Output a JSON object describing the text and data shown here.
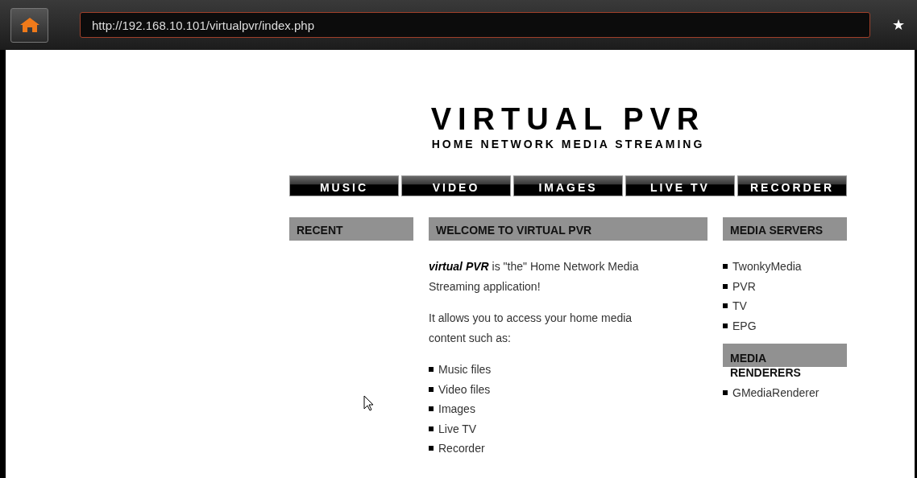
{
  "browser": {
    "url": "http://192.168.10.101/virtualpvr/index.php",
    "bookmark_icon": "★"
  },
  "header": {
    "title": "VIRTUAL PVR",
    "subtitle": "HOME NETWORK MEDIA STREAMING"
  },
  "nav": [
    "MUSIC",
    "VIDEO",
    "IMAGES",
    "LIVE TV",
    "RECORDER"
  ],
  "recent": {
    "heading": "RECENT"
  },
  "welcome": {
    "heading": "WELCOME TO VIRTUAL PVR",
    "paragraphs": [
      "**virtual PVR** is \"the\" Home Network Media Streaming application!",
      "It allows you to access your home media content such as:"
    ],
    "items": [
      "Music files",
      "Video files",
      "Images",
      "Live TV",
      "Recorder"
    ]
  },
  "sections": [
    {
      "heading": "MEDIA SERVERS",
      "items": [
        "TwonkyMedia",
        "PVR",
        "TV",
        "EPG"
      ]
    },
    {
      "heading": "MEDIA RENDERERS",
      "items": [
        "GMediaRenderer"
      ]
    }
  ]
}
